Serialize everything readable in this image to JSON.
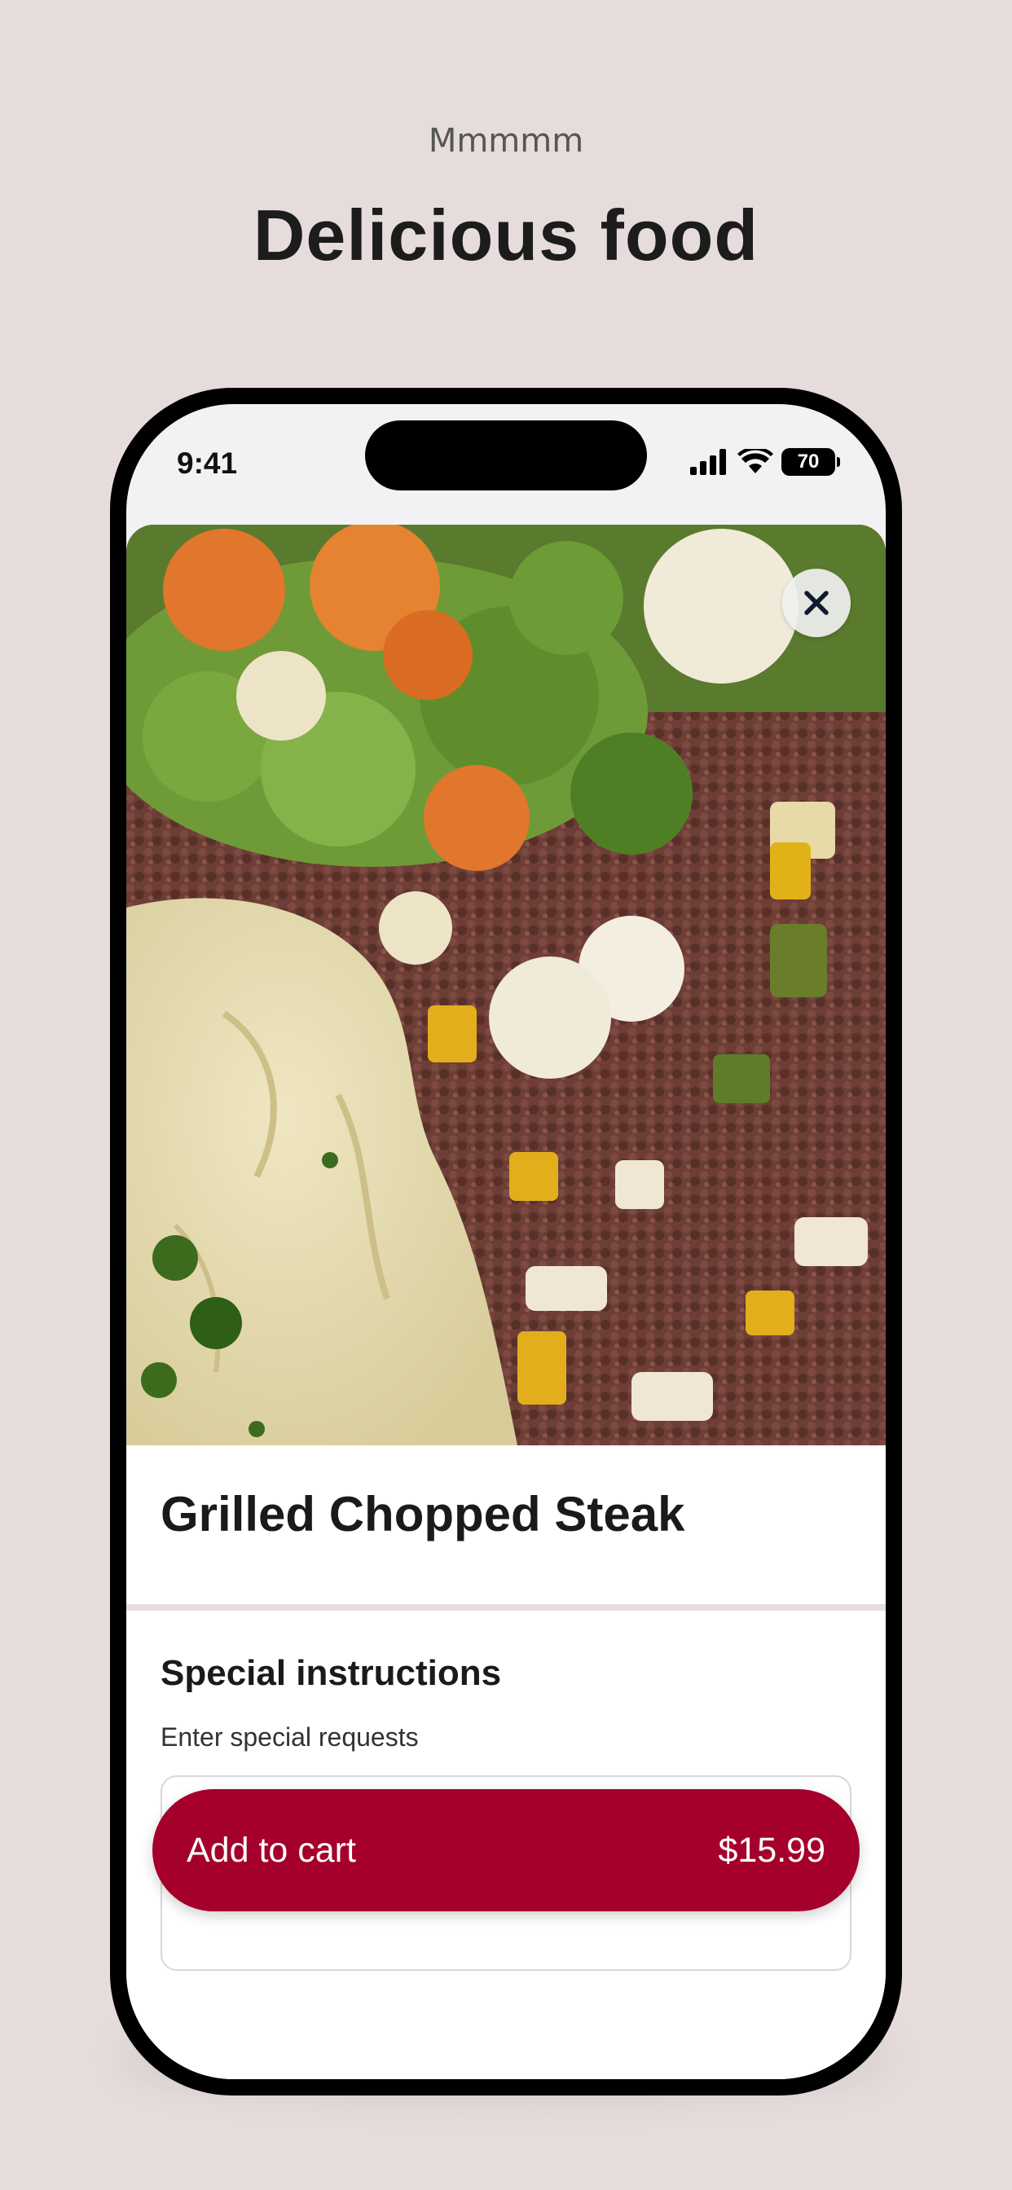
{
  "header": {
    "eyebrow": "Mmmmm",
    "headline": "Delicious food"
  },
  "status_bar": {
    "time": "9:41",
    "battery": "70",
    "icons": [
      "signal-icon",
      "wifi-icon",
      "battery-icon"
    ]
  },
  "item": {
    "image_icon": "food-photo",
    "close_icon": "close-icon",
    "title": "Grilled Chopped Steak"
  },
  "instructions": {
    "title": "Special instructions",
    "subtitle": "Enter special requests",
    "placeholder": "Enter special requests"
  },
  "cart": {
    "label": "Add to cart",
    "price": "$15.99"
  },
  "colors": {
    "background": "#e6dcdc",
    "accent": "#a5002b"
  }
}
